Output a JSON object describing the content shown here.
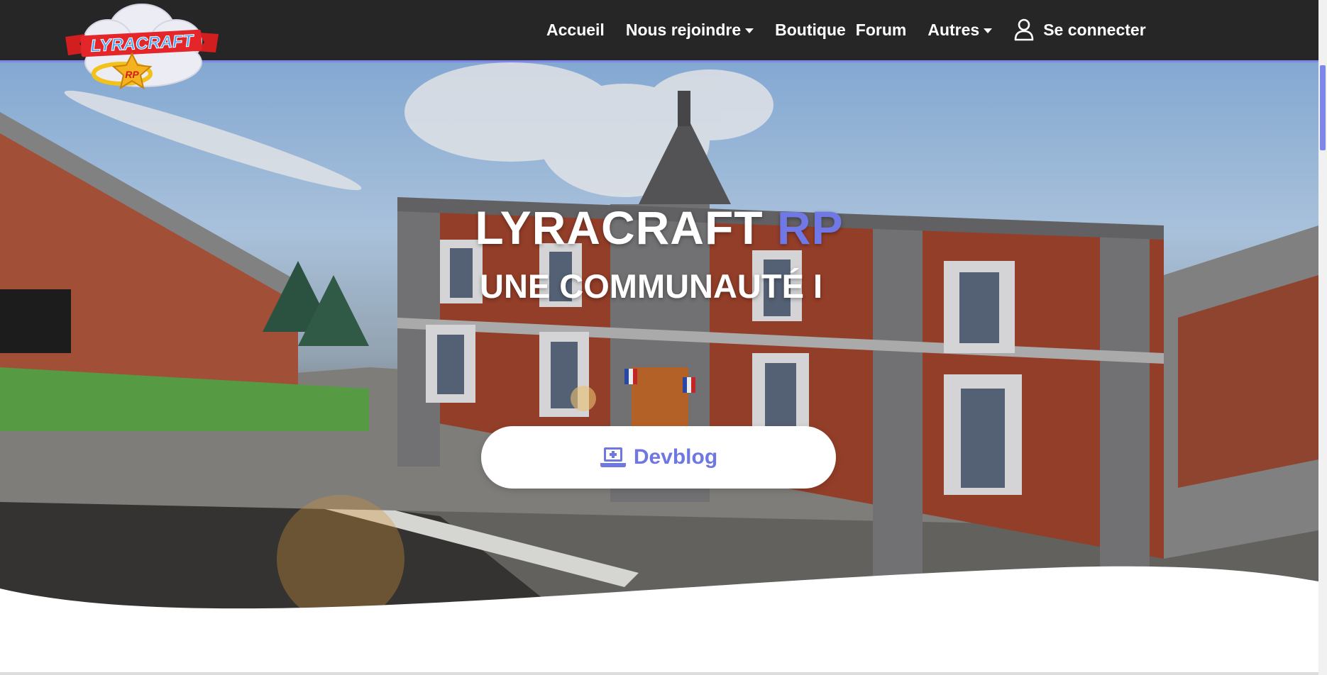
{
  "brand": {
    "logo_text": "LYRACRAFT",
    "logo_badge": "RP"
  },
  "nav": {
    "items": [
      {
        "label": "Accueil",
        "dropdown": false
      },
      {
        "label": "Nous rejoindre",
        "dropdown": true
      },
      {
        "label": "Boutique",
        "dropdown": false
      },
      {
        "label": "Forum",
        "dropdown": false
      },
      {
        "label": "Autres",
        "dropdown": true
      }
    ],
    "login_label": "Se connecter",
    "login_icon": "user-icon"
  },
  "hero": {
    "title_main": "LYRACRAFT",
    "title_accent": "RP",
    "subtitle": "UNE COMMUNAUTÉ I",
    "button_label": "Devblog",
    "button_icon": "laptop-plus-icon"
  },
  "colors": {
    "navbar_bg": "#262626",
    "accent": "#7078e6",
    "white": "#ffffff"
  }
}
